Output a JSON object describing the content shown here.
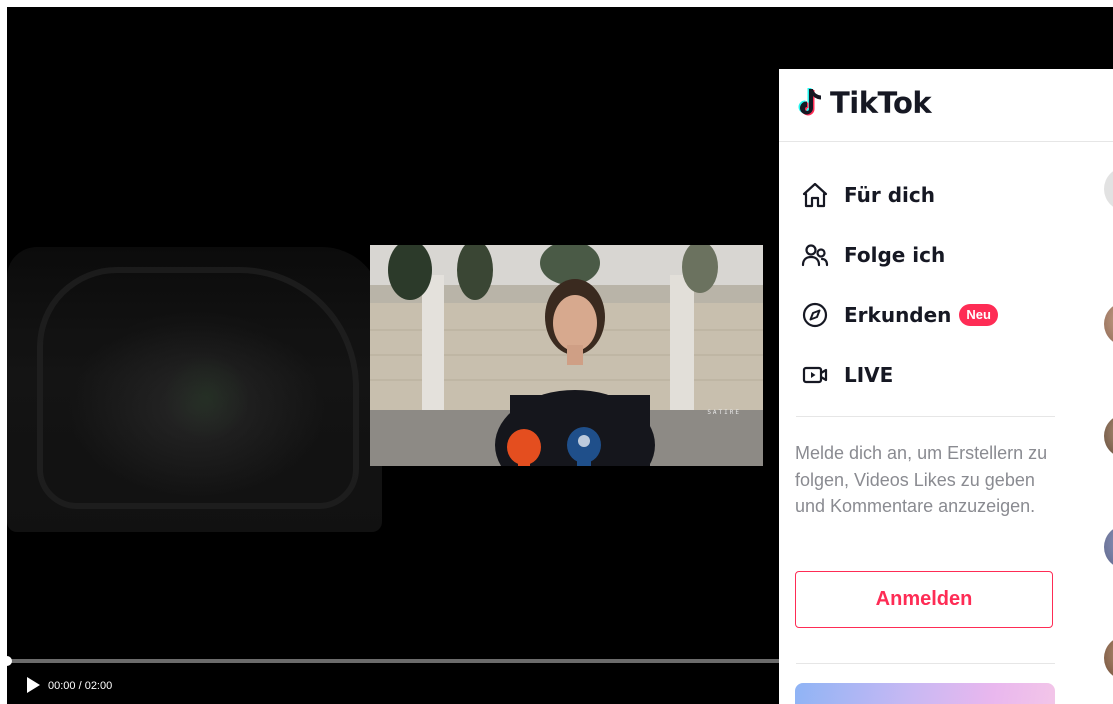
{
  "video": {
    "time_display": "00:00 / 02:00",
    "progress_fraction": 0,
    "overlay_text": "SATIRE"
  },
  "sidebar": {
    "brand_name": "TikTok",
    "nav_items": [
      {
        "label": "Für dich",
        "icon": "home-icon"
      },
      {
        "label": "Folge ich",
        "icon": "users-icon"
      },
      {
        "label": "Erkunden",
        "icon": "compass-icon",
        "badge": "Neu"
      },
      {
        "label": "LIVE",
        "icon": "live-camera-icon"
      }
    ],
    "login_prompt": "Melde dich an, um Erstellern zu folgen, Videos Likes zu geben und Kommentare anzuzeigen.",
    "login_button_label": "Anmelden"
  },
  "colors": {
    "accent": "#fe2c55",
    "text_primary": "#161823",
    "text_secondary": "#8a8b91",
    "video_background": "#000000"
  }
}
